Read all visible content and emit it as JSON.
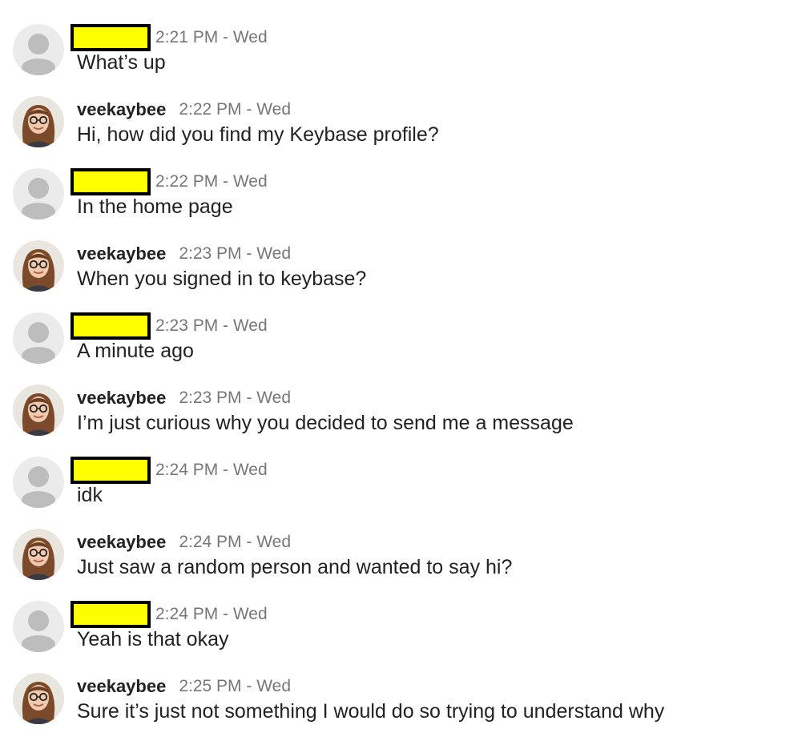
{
  "messages": [
    {
      "sender": "",
      "redacted": true,
      "time": "2:21 PM - Wed",
      "text": "What’s up"
    },
    {
      "sender": "veekaybee",
      "redacted": false,
      "time": "2:22 PM - Wed",
      "text": "Hi, how did you find my Keybase profile?"
    },
    {
      "sender": "",
      "redacted": true,
      "time": "2:22 PM - Wed",
      "text": "In the home page"
    },
    {
      "sender": "veekaybee",
      "redacted": false,
      "time": "2:23 PM - Wed",
      "text": "When you signed in to keybase?"
    },
    {
      "sender": "",
      "redacted": true,
      "time": "2:23 PM - Wed",
      "text": "A minute ago"
    },
    {
      "sender": "veekaybee",
      "redacted": false,
      "time": "2:23 PM - Wed",
      "text": "I’m just curious why you decided to send me a message"
    },
    {
      "sender": "",
      "redacted": true,
      "time": "2:24 PM - Wed",
      "text": "idk"
    },
    {
      "sender": "veekaybee",
      "redacted": false,
      "time": "2:24 PM - Wed",
      "text": "Just saw a random person and wanted to say hi?"
    },
    {
      "sender": "",
      "redacted": true,
      "time": "2:24 PM - Wed",
      "text": "Yeah is that okay"
    },
    {
      "sender": "veekaybee",
      "redacted": false,
      "time": "2:25 PM - Wed",
      "text": "Sure it’s just not something I would do so trying to understand why"
    }
  ],
  "colors": {
    "redaction_fill": "#ffff00",
    "redaction_border": "#000000",
    "timestamp": "#777777",
    "text": "#222222"
  }
}
